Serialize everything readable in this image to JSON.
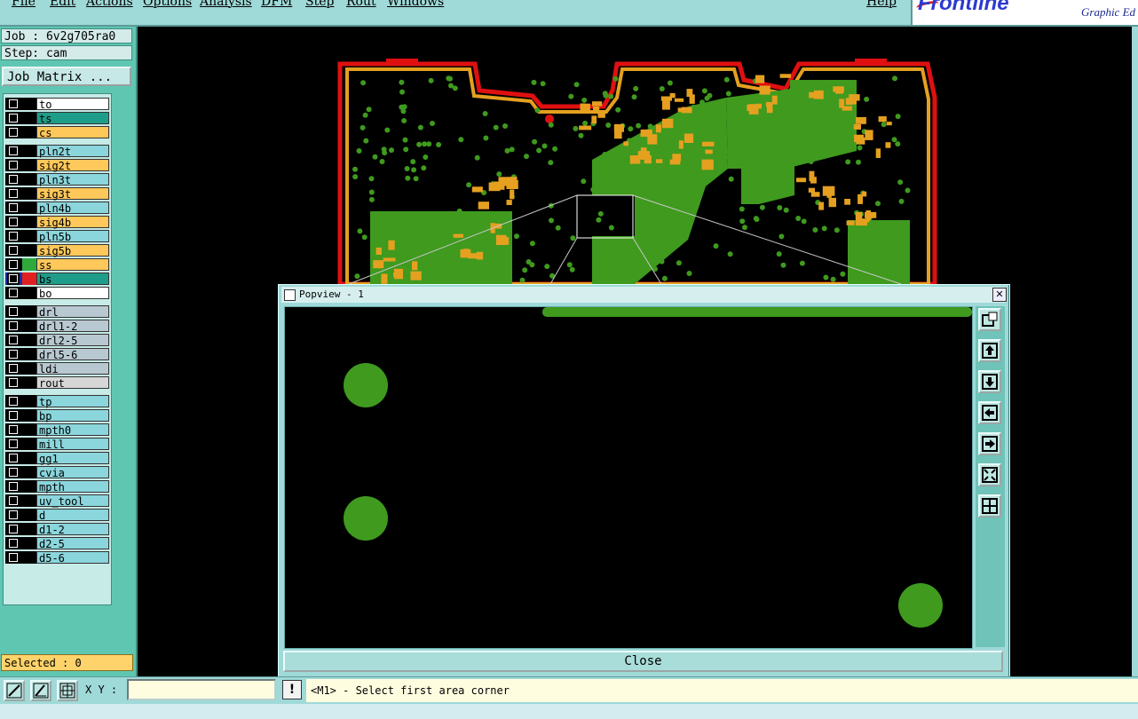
{
  "menu": {
    "items": [
      "File",
      "Edit",
      "Actions",
      "Options",
      "Analysis",
      "DFM",
      "Step",
      "Rout",
      "Windows"
    ],
    "help": "Help"
  },
  "brand": {
    "name": "Frontline",
    "tagline": "Graphic Ed"
  },
  "job": {
    "name_line": "Job : 6v2g705ra0",
    "step_line": "Step: cam",
    "matrix_button": "Job Matrix ..."
  },
  "layers": [
    {
      "name": "to",
      "color": "#ffffff",
      "swatch": "#000000"
    },
    {
      "name": "ts",
      "color": "#1e9e8a",
      "swatch": "#000000"
    },
    {
      "name": "cs",
      "color": "#ffc85a",
      "swatch": "#000000"
    },
    {
      "name": "pln2t",
      "color": "#8ad6dc",
      "swatch": "#000000",
      "gap": true
    },
    {
      "name": "sig2t",
      "color": "#ffc85a",
      "swatch": "#000000"
    },
    {
      "name": "pln3t",
      "color": "#8ad6dc",
      "swatch": "#000000"
    },
    {
      "name": "sig3t",
      "color": "#ffc85a",
      "swatch": "#000000"
    },
    {
      "name": "pln4b",
      "color": "#8ad6dc",
      "swatch": "#000000"
    },
    {
      "name": "sig4b",
      "color": "#ffc85a",
      "swatch": "#000000"
    },
    {
      "name": "pln5b",
      "color": "#8ad6dc",
      "swatch": "#000000"
    },
    {
      "name": "sig5b",
      "color": "#ffc85a",
      "swatch": "#000000"
    },
    {
      "name": "ss",
      "color": "#ffc85a",
      "swatch": "#2eaa3c"
    },
    {
      "name": "bs",
      "color": "#1e9e8a",
      "swatch": "#e02020",
      "active": true
    },
    {
      "name": "bo",
      "color": "#ffffff",
      "swatch": "#000000"
    },
    {
      "name": "drl",
      "color": "#b8c8d0",
      "swatch": "#000000",
      "gap": true
    },
    {
      "name": "drl1-2",
      "color": "#b8c8d0",
      "swatch": "#000000"
    },
    {
      "name": "drl2-5",
      "color": "#b8c8d0",
      "swatch": "#000000"
    },
    {
      "name": "drl5-6",
      "color": "#b8c8d0",
      "swatch": "#000000"
    },
    {
      "name": "ldi",
      "color": "#b8c8d0",
      "swatch": "#000000"
    },
    {
      "name": "rout",
      "color": "#d6d6d6",
      "swatch": "#000000"
    },
    {
      "name": "tp",
      "color": "#8ad6dc",
      "swatch": "#000000",
      "gap": true
    },
    {
      "name": "bp",
      "color": "#8ad6dc",
      "swatch": "#000000"
    },
    {
      "name": "mpth0",
      "color": "#8ad6dc",
      "swatch": "#000000"
    },
    {
      "name": "mill",
      "color": "#8ad6dc",
      "swatch": "#000000"
    },
    {
      "name": "gg1",
      "color": "#8ad6dc",
      "swatch": "#000000"
    },
    {
      "name": "cvia",
      "color": "#8ad6dc",
      "swatch": "#000000"
    },
    {
      "name": "mpth",
      "color": "#8ad6dc",
      "swatch": "#000000"
    },
    {
      "name": "uv_tool",
      "color": "#8ad6dc",
      "swatch": "#000000"
    },
    {
      "name": "d",
      "color": "#8ad6dc",
      "swatch": "#000000"
    },
    {
      "name": "d1-2",
      "color": "#8ad6dc",
      "swatch": "#000000"
    },
    {
      "name": "d2-5",
      "color": "#8ad6dc",
      "swatch": "#000000"
    },
    {
      "name": "d5-6",
      "color": "#8ad6dc",
      "swatch": "#000000"
    }
  ],
  "selected": "Selected : 0",
  "popview": {
    "title": "Popview - 1",
    "close_label": "Close"
  },
  "status": {
    "xy_label": "X Y :",
    "xy_value": "",
    "prompt": "<M1> - Select first area corner"
  },
  "colors": {
    "board_green": "#3f9a1e",
    "pad_orange": "#e5a020",
    "outline_red": "#e01010"
  }
}
